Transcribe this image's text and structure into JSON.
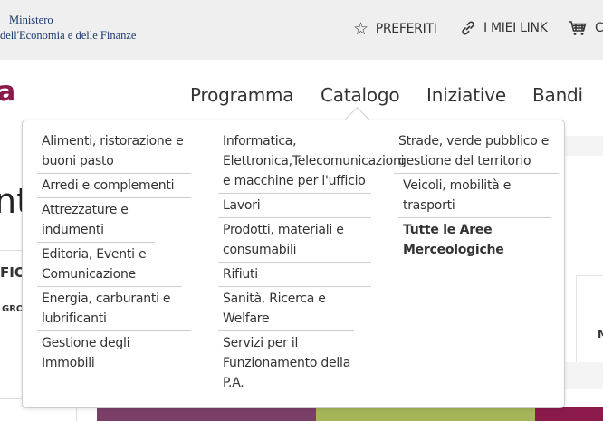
{
  "header": {
    "ministry_line1": "Ministero",
    "ministry_line2": "dell'Economia e delle Finanze",
    "favorites_label": "PREFERITI",
    "my_links_label": "I MIEI LINK",
    "cart_label": "C",
    "icons": {
      "favorites": "star-icon",
      "links": "link-icon",
      "cart": "cart-icon"
    }
  },
  "brand": {
    "partial_letter": "a",
    "color": "#8b1a4b"
  },
  "nav": {
    "items": [
      {
        "label": "Programma"
      },
      {
        "label": "Catalogo"
      },
      {
        "label": "Iniziative"
      },
      {
        "label": "Bandi"
      }
    ]
  },
  "background": {
    "heading_fragment": "nt",
    "section_fragment": "FIO",
    "sub_fragment": "GRO",
    "right_fragment": "M"
  },
  "catalog_menu": {
    "columns": [
      {
        "items": [
          {
            "label": "Alimenti, ristorazione e buoni pasto"
          },
          {
            "label": "Arredi e complementi"
          },
          {
            "label": "Attrezzature e indumenti"
          },
          {
            "label": "Editoria, Eventi e Comunicazione"
          },
          {
            "label": "Energia, carburanti e lubrificanti"
          },
          {
            "label": "Gestione degli Immobili"
          }
        ]
      },
      {
        "items": [
          {
            "label": "Informatica, Elettronica,Telecomunicazioni e macchine per l'ufficio"
          },
          {
            "label": "Lavori"
          },
          {
            "label": "Prodotti, materiali e consumabili"
          },
          {
            "label": "Rifiuti"
          },
          {
            "label": "Sanità, Ricerca e Welfare"
          },
          {
            "label": "Servizi per il Funzionamento della P.A."
          }
        ]
      },
      {
        "items": [
          {
            "label": "Strade, verde pubblico e gestione del territorio"
          },
          {
            "label": "Veicoli, mobilità e trasporti"
          },
          {
            "label": "Tutte le Aree Merceologiche"
          }
        ]
      }
    ]
  }
}
